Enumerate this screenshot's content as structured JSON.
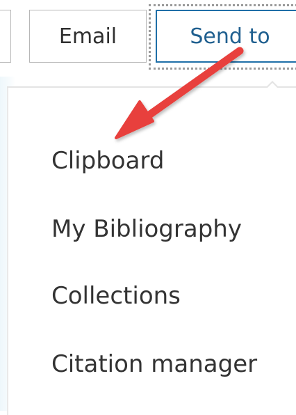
{
  "toolbar": {
    "email_label": "Email",
    "send_to_label": "Send to"
  },
  "send_to_menu": {
    "items": [
      {
        "label": "Clipboard"
      },
      {
        "label": "My Bibliography"
      },
      {
        "label": "Collections"
      },
      {
        "label": "Citation manager"
      }
    ]
  },
  "annotation": {
    "arrow_color": "#e8413d"
  },
  "colors": {
    "send_to_border": "#1f6fa8",
    "send_to_text": "#1f5f8f",
    "menu_text": "#333333"
  }
}
